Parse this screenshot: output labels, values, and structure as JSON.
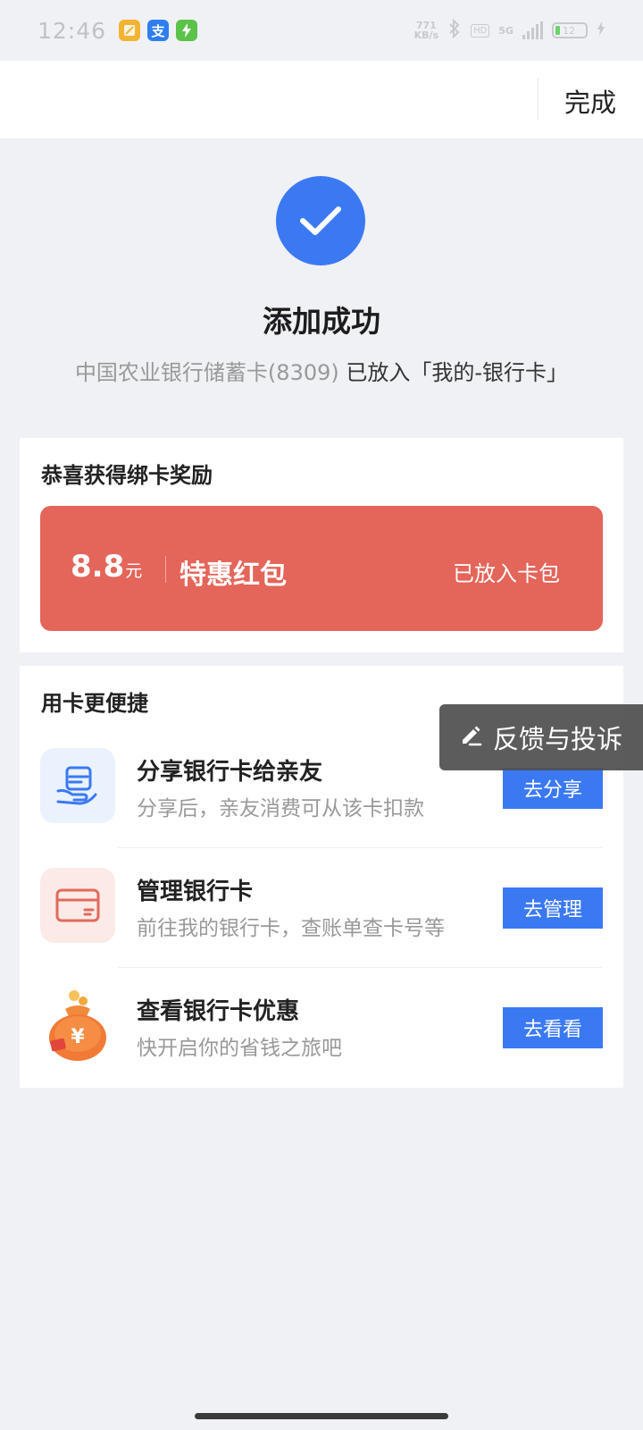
{
  "status_bar": {
    "time": "12:46",
    "net_speed_value": "771",
    "net_speed_unit": "KB/s",
    "network": "5G",
    "hd": "HD",
    "battery": "12"
  },
  "top_bar": {
    "done_label": "完成"
  },
  "success": {
    "title": "添加成功",
    "card_name": "中国农业银行储蓄卡(8309)",
    "placed_text": "已放入「我的-银行卡」",
    "accent_color": "#3b79f3"
  },
  "reward": {
    "title": "恭喜获得绑卡奖励",
    "amount": "8.8",
    "unit": "元",
    "name": "特惠红包",
    "status": "已放入卡包",
    "color": "#e4655a"
  },
  "quick": {
    "title": "用卡更便捷",
    "items": [
      {
        "title": "分享银行卡给亲友",
        "desc": "分享后，亲友消费可从该卡扣款",
        "button": "去分享",
        "icon": "share-card-icon"
      },
      {
        "title": "管理银行卡",
        "desc": "前往我的银行卡，查账单查卡号等",
        "button": "去管理",
        "icon": "bank-card-icon"
      },
      {
        "title": "查看银行卡优惠",
        "desc": "快开启你的省钱之旅吧",
        "button": "去看看",
        "icon": "money-bag-icon"
      }
    ]
  },
  "feedback": {
    "label": "反馈与投诉",
    "icon": "edit-pen-icon"
  }
}
